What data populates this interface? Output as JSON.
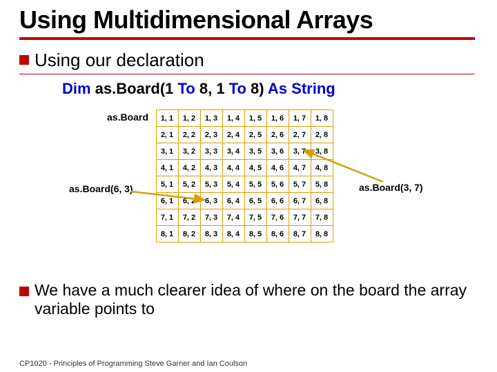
{
  "title": "Using Multidimensional Arrays",
  "bullet1": "Using our declaration",
  "dim": {
    "kw_dim": "Dim",
    "name": " as.Board(1 ",
    "kw_to1": "To",
    "mid": " 8, 1 ",
    "kw_to2": "To",
    "end": " 8) ",
    "kw_as": "As String"
  },
  "labels": {
    "asBoard": "as.Board",
    "ref63": "as.Board(6, 3)",
    "ref37": "as.Board(3, 7)"
  },
  "grid": {
    "rows": 8,
    "cols": 8
  },
  "bullet2": "We have a much clearer idea of where on the board the array variable points to",
  "footer": "CP1020 - Principles of Programming  Steve Garner and Ian Coulson"
}
